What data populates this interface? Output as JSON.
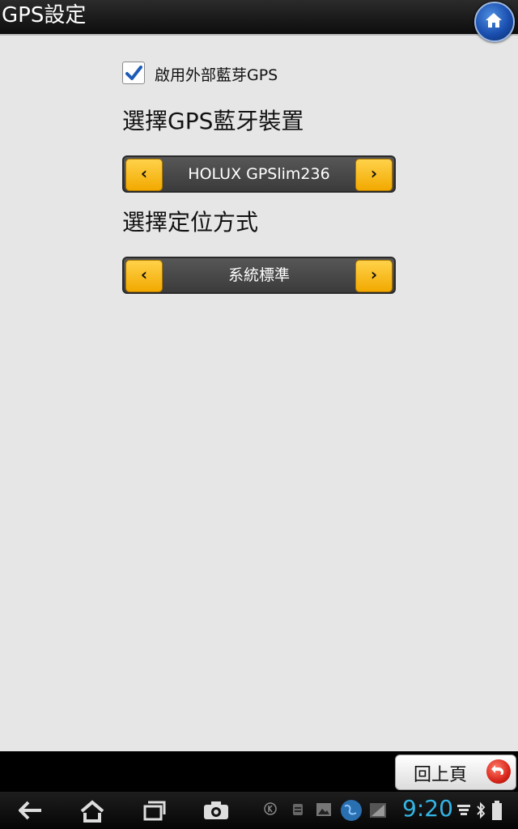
{
  "title_bar": {
    "title": "GPS設定",
    "home_icon": "home-icon"
  },
  "bluetooth": {
    "checkbox_label": "啟用外部藍芽GPS",
    "checked": true
  },
  "device_section": {
    "heading": "選擇GPS藍牙裝置",
    "value": "HOLUX GPSlim236"
  },
  "mode_section": {
    "heading": "選擇定位方式",
    "value": "系統標準"
  },
  "bottom": {
    "back_page_label": "回上頁"
  },
  "system_bar": {
    "time": "9:20",
    "nav_icons": [
      "back-icon",
      "home-icon",
      "recent-apps-icon",
      "camera-icon"
    ],
    "status_icons": [
      "k-icon",
      "notification-icon",
      "gallery-icon",
      "globe-icon",
      "signal-icon",
      "wifi-icon",
      "bluetooth-icon",
      "battery-icon"
    ]
  },
  "colors": {
    "accent_yellow": "#f2a900",
    "clock_blue": "#33b5e5",
    "checkbox_check": "#1e5bb8"
  }
}
